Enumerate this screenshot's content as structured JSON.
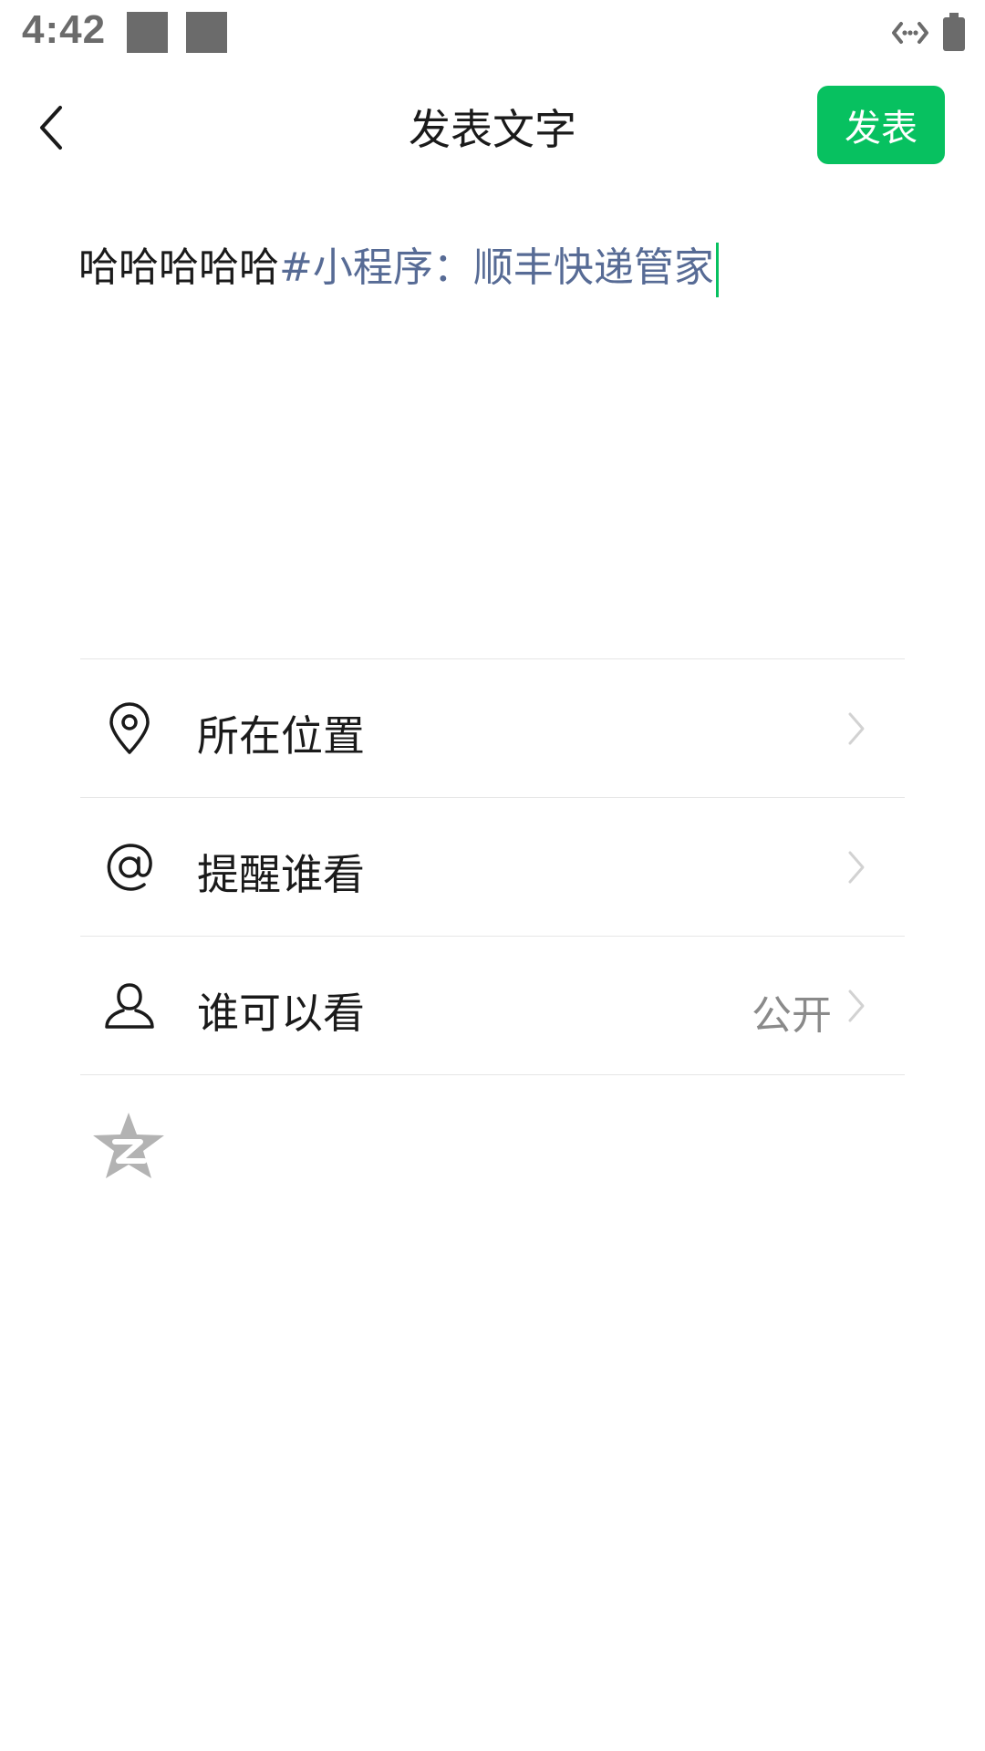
{
  "status_bar": {
    "time": "4:42"
  },
  "header": {
    "title": "发表文字",
    "post_label": "发表"
  },
  "composer": {
    "text_plain": "哈哈哈哈哈",
    "text_link": "#小程序：顺丰快递管家"
  },
  "options": [
    {
      "label": "所在位置",
      "icon": "location-pin-icon",
      "value": ""
    },
    {
      "label": "提醒谁看",
      "icon": "at-sign-icon",
      "value": ""
    },
    {
      "label": "谁可以看",
      "icon": "person-icon",
      "value": "公开"
    }
  ],
  "share": {
    "icon": "qzone-star-icon"
  },
  "colors": {
    "accent_green": "#07c160",
    "link_blue": "#576b95",
    "secondary_text": "#8a8a8a",
    "divider": "#e6e6e6"
  }
}
